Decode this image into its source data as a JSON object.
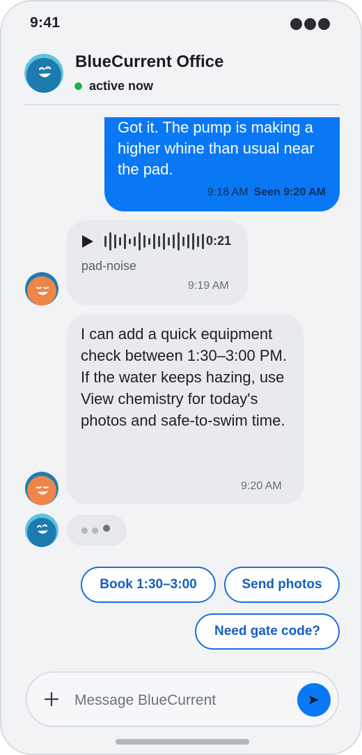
{
  "status_bar": {
    "time": "9:41"
  },
  "header": {
    "contact_name": "BlueCurrent Office",
    "presence": "active now",
    "avatar_icon": "office-avatar-icon"
  },
  "messages": [
    {
      "direction": "outgoing",
      "text": "Got it. The pump is making a higher whine than usual near the pad.",
      "time": "9:18 AM",
      "receipt": "Seen 9:20 AM"
    },
    {
      "direction": "incoming",
      "type": "voice",
      "duration": "0:21",
      "label": "pad-noise",
      "time": "9:19 AM"
    },
    {
      "direction": "incoming",
      "text": "I can add a quick equipment check between 1:30–3:00 PM. If the water keeps hazing, use View chemistry for today's photos and safe-to-swim time.",
      "time": "9:20 AM"
    }
  ],
  "quick_replies": [
    "Book 1:30–3:00",
    "Send photos",
    "Need gate code?"
  ],
  "composer": {
    "placeholder": "Message BlueCurrent",
    "value": ""
  },
  "colors": {
    "accent": "#0a78f5",
    "chip_border": "#1b6fd6",
    "online": "#23b14d",
    "office_avatar": "#1e7bb0",
    "agent_avatar": "#f0854a"
  }
}
